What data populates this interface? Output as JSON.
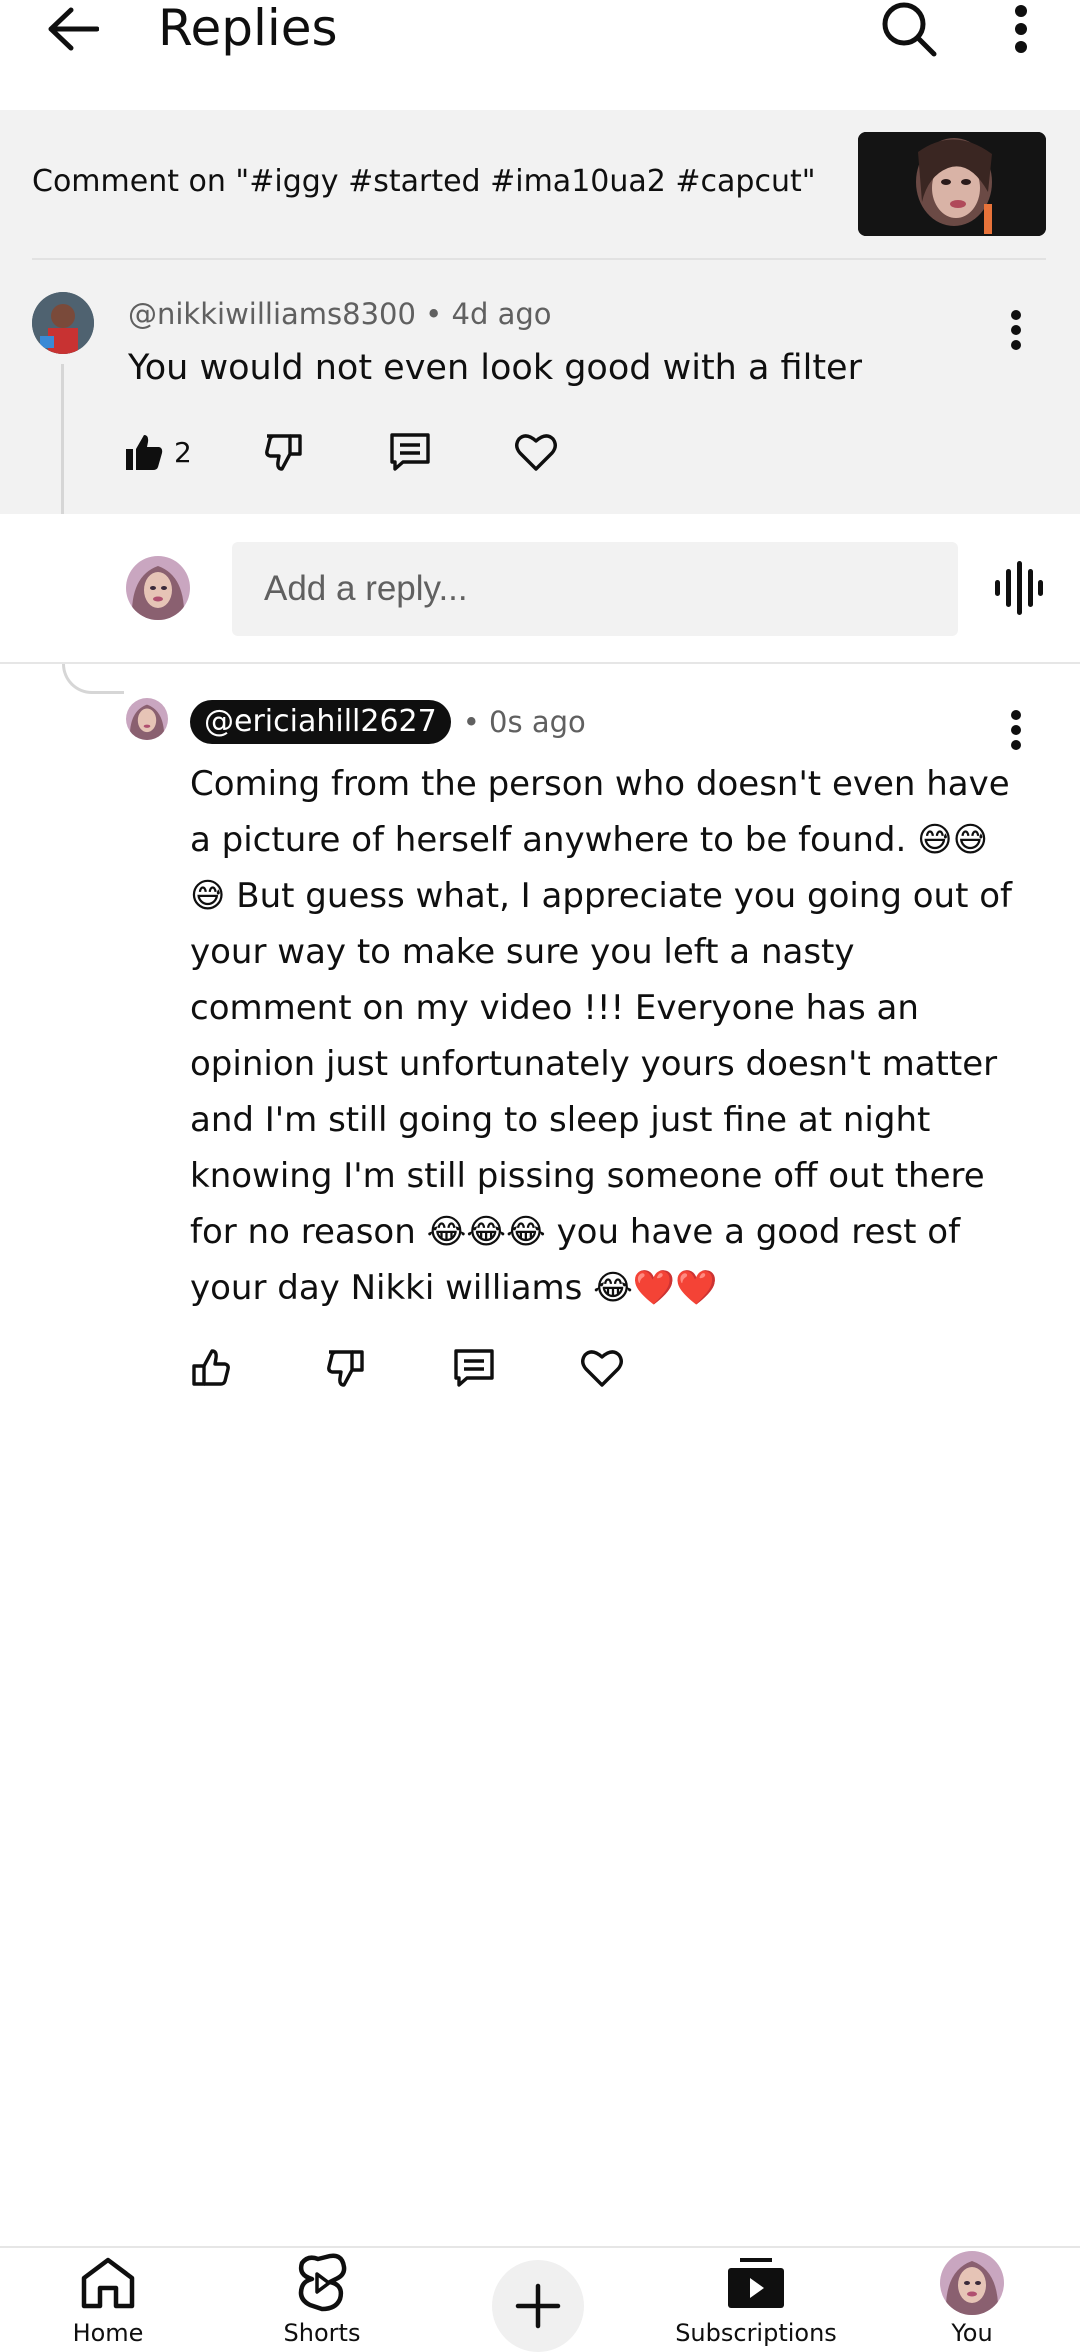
{
  "header": {
    "title": "Replies",
    "back_icon": "arrow-left-icon",
    "search_icon": "search-icon",
    "more_icon": "more-vertical-icon"
  },
  "context": {
    "text": "Comment on \"#iggy #started #ima10ua2 #capcut\""
  },
  "parent_comment": {
    "meta": "@nikkiwilliams8300 • 4d ago",
    "text": "You would not even look good with a filter",
    "like_count": "2"
  },
  "reply_input": {
    "placeholder": "Add a reply...",
    "value": ""
  },
  "reply": {
    "handle": "@ericiahill2627",
    "time": "• 0s ago",
    "text": "Coming from the person who doesn't even have a picture of herself anywhere to be found. 😅😅😅 But guess what, I appreciate you going out of your way to make sure you left a nasty comment on my video !!! Everyone has an opinion just unfortunately yours doesn't matter and I'm still going to sleep just fine at night knowing I'm still pissing someone off out there for no reason 😂😂😂 you have a good rest of your day Nikki williams 😂❤️❤️"
  },
  "nav": {
    "home": "Home",
    "shorts": "Shorts",
    "subscriptions": "Subscriptions",
    "you": "You"
  },
  "colors": {
    "background": "#ffffff",
    "panel": "#f2f2f2",
    "text": "#0f0f0f",
    "secondary_text": "#606060"
  }
}
